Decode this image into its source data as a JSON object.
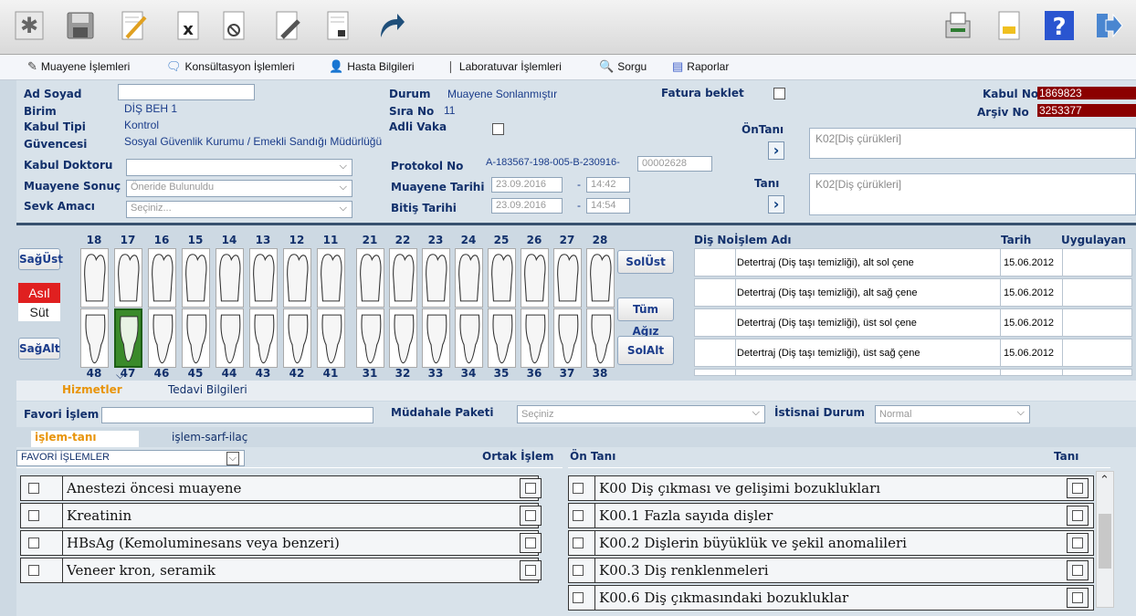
{
  "toolbar": {
    "icons": [
      "new-icon",
      "save-icon",
      "edit-icon",
      "delete-icon",
      "cancel-icon",
      "sign-icon",
      "lock-document-icon",
      "redirect-icon",
      "print-icon",
      "report-icon",
      "help-icon",
      "exit-icon"
    ]
  },
  "menu": {
    "items": [
      "Muayene İşlemleri",
      "Konsültasyon İşlemleri",
      "Hasta Bilgileri",
      "Laboratuvar İşlemleri",
      "Sorgu",
      "Raporlar"
    ]
  },
  "patient": {
    "ad_soyad_label": "Ad Soyad",
    "birim_label": "Birim",
    "birim": "DİŞ BEH 1",
    "kabul_tipi_label": "Kabul Tipi",
    "kabul_tipi": "Kontrol",
    "guvence_label": "Güvencesi",
    "guvence": "Sosyal Güvenlik Kurumu / Emekli Sandığı Müdürlüğü",
    "kabul_doktoru_label": "Kabul Doktoru",
    "muayene_sonuc_label": "Muayene Sonuç",
    "muayene_sonuc": "Öneride Bulunuldu",
    "sevk_amaci_label": "Sevk Amacı",
    "sevk_amaci": "Seçiniz...",
    "durum_label": "Durum",
    "durum": "Muayene Sonlanmıştır",
    "sira_no_label": "Sıra No",
    "sira_no": "11",
    "adli_vaka_label": "Adli Vaka",
    "protokol_no_label": "Protokol No",
    "protokol_no": "A-183567-198-005-B-230916-",
    "protokol_no_suffix": "00002628",
    "muayene_tarihi_label": "Muayene Tarihi",
    "muayene_tarihi": "23.09.2016",
    "muayene_saati": "14:42",
    "bitis_tarihi_label": "Bitiş Tarihi",
    "bitis_tarihi": "23.09.2016",
    "bitis_saati": "14:54",
    "dash": "-",
    "fatura_beklet_label": "Fatura beklet",
    "kabul_no_label": "Kabul No",
    "kabul_no": "1869823",
    "arsiv_no_label": "Arşiv No",
    "arsiv_no": "3253377",
    "on_tani_label": "ÖnTanı",
    "on_tani": "K02[Diş çürükleri]",
    "tani_label": "Tanı",
    "tani": "K02[Diş çürükleri]"
  },
  "teeth": {
    "upper_numbers": [
      "18",
      "17",
      "16",
      "15",
      "14",
      "13",
      "12",
      "11",
      "21",
      "22",
      "23",
      "24",
      "25",
      "26",
      "27",
      "28"
    ],
    "lower_numbers": [
      "48",
      "47",
      "46",
      "45",
      "44",
      "43",
      "42",
      "41",
      "31",
      "32",
      "33",
      "34",
      "35",
      "36",
      "37",
      "38"
    ],
    "selected": "47",
    "buttons": {
      "sag_ust": "SağÜst",
      "asil": "Asıl",
      "sut": "Süt",
      "sag_alt": "SağAlt",
      "sol_ust": "SolÜst",
      "tum_agiz": "Tüm Ağız",
      "sol_alt": "SolAlt"
    }
  },
  "history": {
    "headers": {
      "dis_no": "Diş No",
      "islem_adi": "İşlem Adı",
      "tarih": "Tarih",
      "uygulayan": "Uygulayan"
    },
    "rows": [
      {
        "islem": "Detertraj (Diş taşı temizliği), alt sol çene",
        "tarih": "15.06.2012"
      },
      {
        "islem": "Detertraj (Diş taşı temizliği), alt sağ çene",
        "tarih": "15.06.2012"
      },
      {
        "islem": "Detertraj (Diş taşı temizliği), üst sol çene",
        "tarih": "15.06.2012"
      },
      {
        "islem": "Detertraj (Diş taşı temizliği), üst sağ çene",
        "tarih": "15.06.2012"
      }
    ]
  },
  "tabs": {
    "hizmetler": "Hizmetler",
    "tedavi_bilgileri": "Tedavi Bilgileri",
    "islem_tani": "işlem-tanı",
    "islem_sarf_ilac": "işlem-sarf-ilaç"
  },
  "favori": {
    "favori_islem_label": "Favori İşlem",
    "mudahale_paketi_label": "Müdahale Paketi",
    "mudahale_paketi": "Seçiniz",
    "istisnai_durum_label": "İstisnai Durum",
    "istisnai_durum": "Normal",
    "favori_islemler": "FAVORİ İŞLEMLER",
    "ortak_islem_label": "Ortak İşlem",
    "on_tani_col": "Ön Tanı",
    "tani_col": "Tanı"
  },
  "islemler": [
    "Anestezi öncesi muayene",
    "Kreatinin",
    "HBsAg (Kemoluminesans veya benzeri)",
    "Veneer kron, seramik"
  ],
  "tanilar": [
    "K00 Diş çıkması ve gelişimi bozuklukları",
    "K00.1 Fazla sayıda dişler",
    "K00.2 Dişlerin büyüklük ve şekil anomalileri",
    "K00.3 Diş renklenmeleri",
    "K00.6 Diş çıkmasındaki bozukluklar"
  ],
  "colors": {
    "accent_dark_red": "#8b0000",
    "selected_tooth": "#3a8a2a",
    "asil_red": "#e02020",
    "tab_orange": "#e8940a"
  }
}
